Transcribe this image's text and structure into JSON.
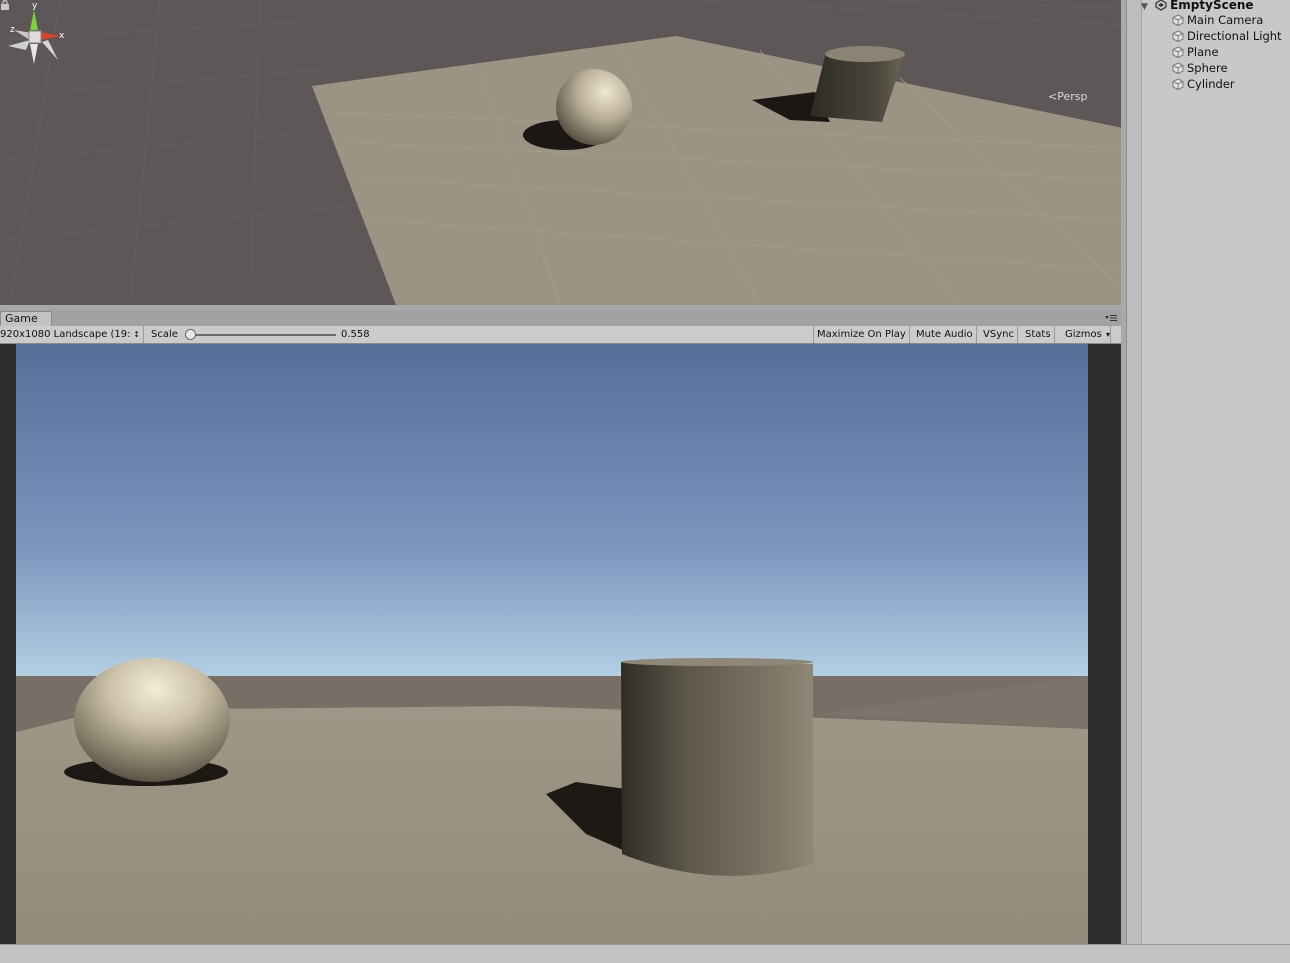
{
  "scene_view": {
    "projection_label": "Persp",
    "axis_labels": {
      "y": "y",
      "x": "x",
      "z": "z"
    },
    "lock_icon": "lock-icon"
  },
  "game_tab": {
    "label": "Game"
  },
  "game_toolbar": {
    "resolution": "920x1080 Landscape (19:",
    "scale_label": "Scale",
    "scale_value": "0.558",
    "maximize": "Maximize On Play",
    "mute": "Mute Audio",
    "vsync": "VSync",
    "stats": "Stats",
    "gizmos": "Gizmos"
  },
  "hierarchy": {
    "scene_name": "EmptyScene",
    "items": [
      {
        "label": "Main Camera",
        "icon": "gameobject-cube-icon"
      },
      {
        "label": "Directional Light",
        "icon": "gameobject-cube-icon"
      },
      {
        "label": "Plane",
        "icon": "gameobject-cube-icon"
      },
      {
        "label": "Sphere",
        "icon": "gameobject-cube-icon"
      },
      {
        "label": "Cylinder",
        "icon": "gameobject-cube-icon"
      }
    ]
  },
  "colors": {
    "sky_top": "#556f98",
    "sky_horizon": "#eaf7fb",
    "ground": "#9a9280",
    "scene_bg": "#5e5757"
  }
}
